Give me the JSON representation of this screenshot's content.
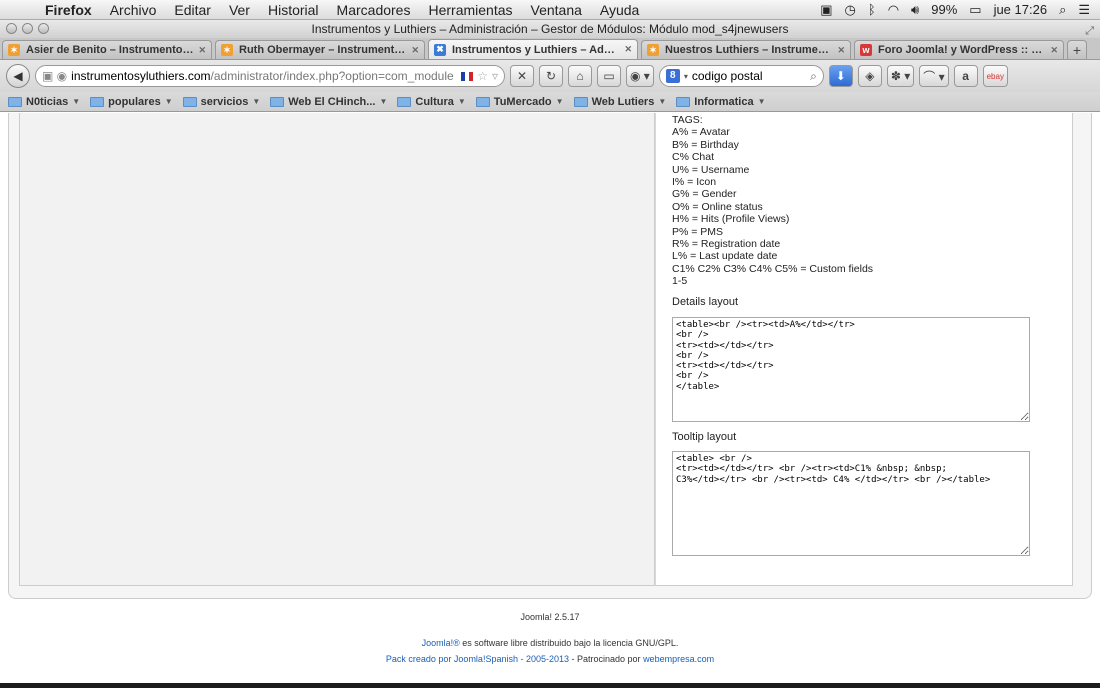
{
  "menubar": {
    "app": "Firefox",
    "items": [
      "Archivo",
      "Editar",
      "Ver",
      "Historial",
      "Marcadores",
      "Herramientas",
      "Ventana",
      "Ayuda"
    ],
    "battery": "99%",
    "clock": "jue 17:26"
  },
  "window": {
    "title": "Instrumentos y Luthiers – Administración – Gestor de Módulos: Módulo mod_s4jnewusers"
  },
  "tabs": [
    {
      "label": "Asier de Benito – Instrumentos ...",
      "favicon_color": "#f0a030"
    },
    {
      "label": "Ruth Obermayer – Instrumento...",
      "favicon_color": "#f0a030"
    },
    {
      "label": "Instrumentos y Luthiers – Admi...",
      "favicon_color": "#3a7bd5",
      "active": true
    },
    {
      "label": "Nuestros Luthiers – Instrument...",
      "favicon_color": "#f0a030"
    },
    {
      "label": "Foro Joomla! y WordPress :: Dis...",
      "favicon_color": "#d9383a"
    }
  ],
  "urlbar": {
    "host": "instrumentosyluthiers.com",
    "path": "/administrator/index.php?option=com_module"
  },
  "search": {
    "value": "codigo postal",
    "engine_icon": "google-icon"
  },
  "bookmarks": [
    "N0ticias",
    "populares",
    "servicios",
    "Web El CHinch...",
    "Cultura",
    "TuMercado",
    "Web Lutiers",
    "Informatica"
  ],
  "tags_help": [
    "TAGS:",
    "A% = Avatar",
    "B% = Birthday",
    "C% Chat",
    "U% = Username",
    "I% = Icon",
    "G% = Gender",
    "O% = Online status",
    "H% = Hits (Profile Views)",
    "P% = PMS",
    "R% = Registration date",
    "L% = Last update date",
    "C1% C2% C3% C4% C5% = Custom fields",
    "1-5"
  ],
  "details": {
    "label": "Details layout",
    "value": "<table><br /><tr><td>A%</td></tr>\n<br />\n<tr><td></td></tr>\n<br />\n<tr><td></td></tr>\n<br />\n</table>"
  },
  "tooltip": {
    "label": "Tooltip layout",
    "value": "<table> <br />\n<tr><td></td></tr> <br /><tr><td>C1% &nbsp; &nbsp;\nC3%</td></tr> <br /><tr><td> C4% </td></tr> <br /></table>"
  },
  "footer": {
    "version": "Joomla! 2.5.17",
    "license_link": "Joomla!®",
    "license_text": " es software libre distribuido bajo la licencia GNU/GPL.",
    "pack_link": "Pack creado por Joomla!Spanish - 2005-2013",
    "sponsor_text": " - Patrocinado por ",
    "sponsor_link": "webempresa.com"
  }
}
